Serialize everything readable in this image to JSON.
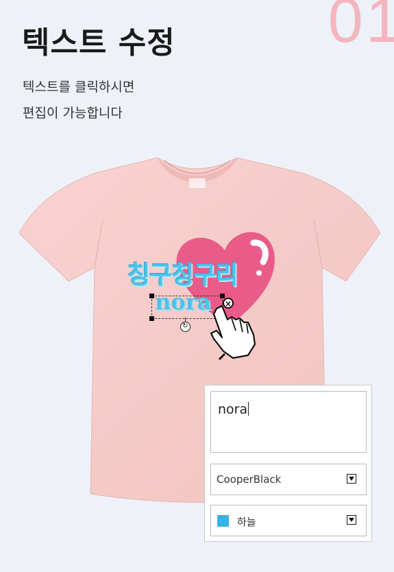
{
  "step_number": "01",
  "title": "텍스트 수정",
  "description": [
    "텍스트를 클릭하시면",
    "편집이 가능합니다"
  ],
  "design": {
    "text_line": "칭구칭구리",
    "name_line": "nora",
    "text_color": "#4cc3ea",
    "heart_color": "#ea5d89",
    "shirt_color": "#f7cdca"
  },
  "editor": {
    "text_value": "nora",
    "font_value": "CooperBlack",
    "color_value": "하늘",
    "color_swatch": "#39b2e6"
  },
  "icons": [
    "delete-icon",
    "rotate-icon",
    "hand-pointer-icon",
    "dropdown-arrow-icon"
  ]
}
